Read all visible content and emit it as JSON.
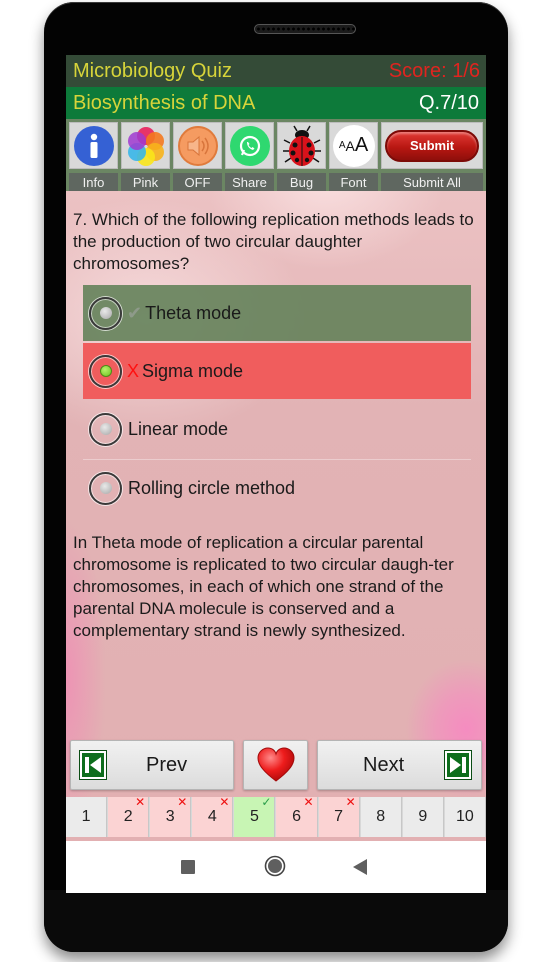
{
  "header": {
    "app_title": "Microbiology Quiz",
    "score": "Score: 1/6",
    "topic": "Biosynthesis of DNA",
    "question_counter": "Q.7/10"
  },
  "toolbar": {
    "items": [
      {
        "label": "Info",
        "icon": "info-icon"
      },
      {
        "label": "Pink",
        "icon": "color-theme-icon"
      },
      {
        "label": "OFF",
        "icon": "speaker-icon"
      },
      {
        "label": "Share",
        "icon": "whatsapp-icon"
      },
      {
        "label": "Bug",
        "icon": "ladybug-icon"
      },
      {
        "label": "Font",
        "icon": "font-size-icon",
        "glyph_small": "A",
        "glyph_mid": "A",
        "glyph_large": "A"
      },
      {
        "label": "Submit All",
        "icon": "submit-icon",
        "button_text": "Submit"
      }
    ]
  },
  "question": {
    "text": "7. Which of the following replication methods leads to the production of two circular daughter chromosomes?",
    "options": [
      {
        "text": "Theta mode",
        "status": "correct",
        "mark": "✔",
        "selected": false
      },
      {
        "text": "Sigma mode",
        "status": "wrong",
        "mark": "X",
        "selected": true
      },
      {
        "text": "Linear mode",
        "status": "none",
        "mark": "",
        "selected": false
      },
      {
        "text": "Rolling circle method",
        "status": "none",
        "mark": "",
        "selected": false
      }
    ]
  },
  "explanation": "In Theta mode of replication a circular parental chromosome is replicated to two circular daugh-ter chromosomes, in each of which one strand of the parental DNA molecule is conserved and a complementary strand is newly synthesized.",
  "navigation": {
    "prev_label": "Prev",
    "next_label": "Next",
    "favorite_icon": "heart-icon"
  },
  "question_grid": [
    {
      "num": "1",
      "status": "unanswered"
    },
    {
      "num": "2",
      "status": "wrong",
      "badge": "✕"
    },
    {
      "num": "3",
      "status": "wrong",
      "badge": "✕"
    },
    {
      "num": "4",
      "status": "wrong",
      "badge": "✕"
    },
    {
      "num": "5",
      "status": "correct",
      "badge": "✓"
    },
    {
      "num": "6",
      "status": "wrong",
      "badge": "✕"
    },
    {
      "num": "7",
      "status": "wrong",
      "badge": "✕"
    },
    {
      "num": "8",
      "status": "unanswered"
    },
    {
      "num": "9",
      "status": "unanswered"
    },
    {
      "num": "10",
      "status": "unanswered"
    }
  ],
  "colors": {
    "title_bar": "#344b37",
    "sub_bar": "#0d7a3a",
    "title_text": "#d7d43a",
    "score_text": "#e0241f",
    "correct_option": "#64825a",
    "wrong_option": "#f05d5d"
  }
}
